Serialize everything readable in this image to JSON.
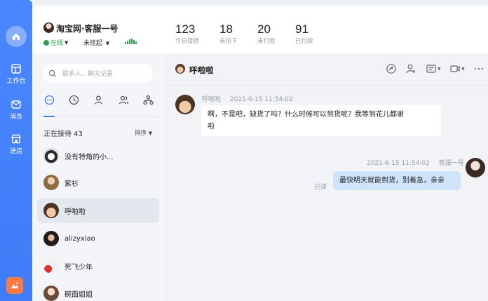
{
  "rail": {
    "items": [
      {
        "label": "工作台",
        "icon": "workbench-icon"
      },
      {
        "label": "消息",
        "icon": "message-icon"
      },
      {
        "label": "进店",
        "icon": "store-icon"
      }
    ],
    "home_icon": "home-icon",
    "bottom_icon": "app-logo-icon",
    "accent": "#3f7cf7"
  },
  "header": {
    "shop_name": "淘宝网·客服一号",
    "status": "在线",
    "hang_status": "未挂起",
    "stats": [
      {
        "value": "123",
        "label": "今日接待"
      },
      {
        "value": "18",
        "label": "未拍下"
      },
      {
        "value": "20",
        "label": "未付款"
      },
      {
        "value": "91",
        "label": "已付款"
      }
    ]
  },
  "sidebar": {
    "search_placeholder": "联系人、聊天记录",
    "receiving_label": "正在接待 43",
    "sort_label": "排序",
    "contacts": [
      {
        "name": "没有特角的小..."
      },
      {
        "name": "紫衫"
      },
      {
        "name": "呼啦啦"
      },
      {
        "name": "alizyxiao"
      },
      {
        "name": "死飞少年"
      },
      {
        "name": "碗面姐姐"
      }
    ]
  },
  "chat": {
    "title": "呼啦啦",
    "messages": [
      {
        "sender": "呼啦啦",
        "time": "2021-6-15 11:54:02",
        "lines": [
          "啊，不是吧，缺货了吗？什么时候可以到货呢？我等到花儿都谢",
          "啦"
        ]
      },
      {
        "sender": "客服一号",
        "time": "2021-6-15 11:54:02",
        "text": "最快明天就能到货，别着急，亲亲",
        "read": "已读"
      }
    ]
  }
}
